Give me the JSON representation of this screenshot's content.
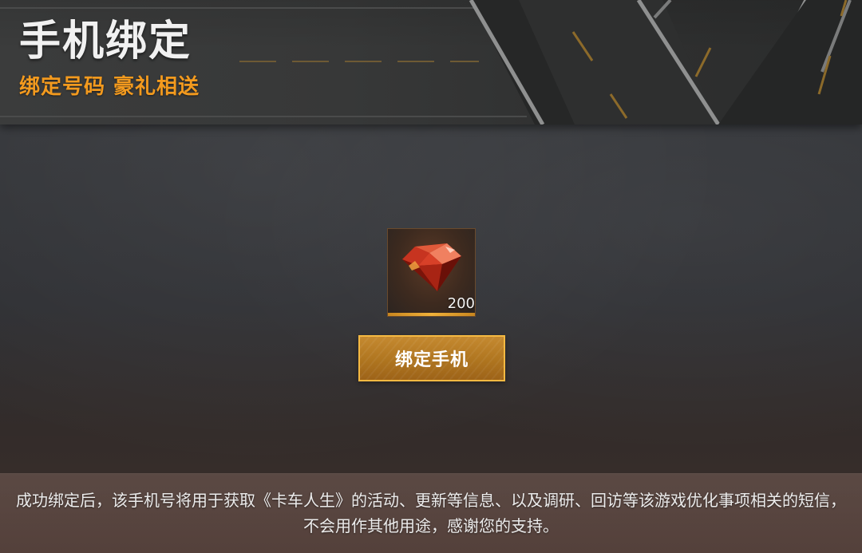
{
  "header": {
    "title": "手机绑定",
    "subtitle": "绑定号码 豪礼相送"
  },
  "reward": {
    "icon": "red-gem-icon",
    "count": "200"
  },
  "bind_button": {
    "label": "绑定手机"
  },
  "footer": {
    "notice": "成功绑定后，该手机号将用于获取《卡车人生》的活动、更新等信息、以及调研、回访等该游戏优化事项相关的短信，不会用作其他用途，感谢您的支持。"
  },
  "colors": {
    "accent_orange": "#f39a1e",
    "button_gold": "#b27418",
    "button_border": "#f5b942"
  }
}
